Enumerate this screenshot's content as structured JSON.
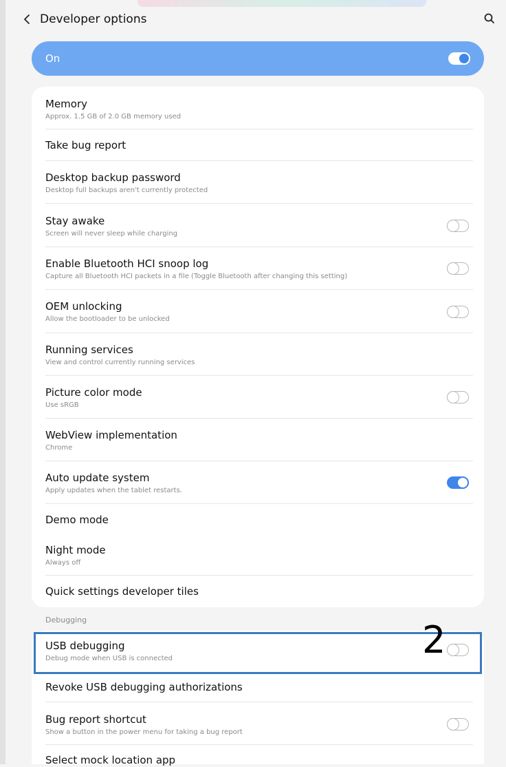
{
  "header": {
    "back_icon": "chevron-left-icon",
    "title": "Developer options",
    "search_icon": "search-icon"
  },
  "master": {
    "label": "On",
    "toggle_state": "on"
  },
  "settings": [
    {
      "title": "Memory",
      "subtitle": "Approx. 1.5 GB of 2.0 GB memory used",
      "toggle": null
    },
    {
      "title": "Take bug report",
      "subtitle": "",
      "toggle": null
    },
    {
      "title": "Desktop backup password",
      "subtitle": "Desktop full backups aren't currently protected",
      "toggle": null
    },
    {
      "title": "Stay awake",
      "subtitle": "Screen will never sleep while charging",
      "toggle": "off"
    },
    {
      "title": "Enable Bluetooth HCI snoop log",
      "subtitle": "Capture all Bluetooth HCI packets in a file (Toggle Bluetooth after changing this setting)",
      "toggle": "off"
    },
    {
      "title": "OEM unlocking",
      "subtitle": "Allow the bootloader to be unlocked",
      "toggle": "off"
    },
    {
      "title": "Running services",
      "subtitle": "View and control currently running services",
      "toggle": null
    },
    {
      "title": "Picture color mode",
      "subtitle": "Use sRGB",
      "toggle": "off"
    },
    {
      "title": "WebView implementation",
      "subtitle": "Chrome",
      "toggle": null
    },
    {
      "title": "Auto update system",
      "subtitle": "Apply updates when the tablet restarts.",
      "toggle": "on"
    },
    {
      "title": "Demo mode",
      "subtitle": "",
      "toggle": null
    },
    {
      "title": "Night mode",
      "subtitle": "Always off",
      "toggle": null
    },
    {
      "title": "Quick settings developer tiles",
      "subtitle": "",
      "toggle": null
    }
  ],
  "debugging": {
    "section_label": "Debugging",
    "items": [
      {
        "title": "USB debugging",
        "subtitle": "Debug mode when USB is connected",
        "toggle": "off"
      },
      {
        "title": "Revoke USB debugging authorizations",
        "subtitle": "",
        "toggle": null
      },
      {
        "title": "Bug report shortcut",
        "subtitle": "Show a button in the power menu for taking a bug report",
        "toggle": "off"
      },
      {
        "title": "Select mock location app",
        "subtitle": "",
        "toggle": null
      }
    ]
  },
  "annotation": {
    "step_number": "2",
    "highlight_color": "#3a7bbf"
  },
  "colors": {
    "accent": "#3f86ea",
    "master_bar": "#6ea8f3",
    "background": "#f4f4f4"
  }
}
